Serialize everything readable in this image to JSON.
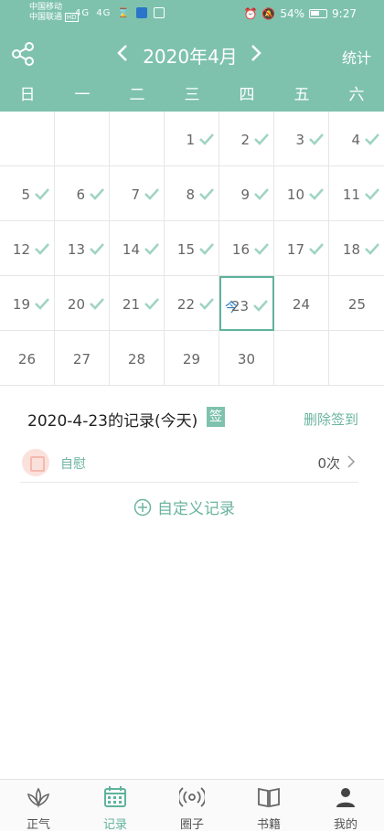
{
  "status_bar": {
    "carrier1": "中国移动",
    "carrier2": "中国联通",
    "hd": "HD",
    "signal1": "4G",
    "signal2": "4G",
    "battery": "54%",
    "time": "9:27"
  },
  "header": {
    "month_title": "2020年4月",
    "stats_label": "统计",
    "share_icon": "share-icon",
    "prev_icon": "chevron-left-icon",
    "next_icon": "chevron-right-icon",
    "bg_color": "#7ec2ad"
  },
  "weekdays": [
    "日",
    "一",
    "二",
    "三",
    "四",
    "五",
    "六"
  ],
  "calendar": {
    "rows": [
      [
        {
          "d": "",
          "c": false
        },
        {
          "d": "",
          "c": false
        },
        {
          "d": "",
          "c": false
        },
        {
          "d": "1",
          "c": true
        },
        {
          "d": "2",
          "c": true
        },
        {
          "d": "3",
          "c": true
        },
        {
          "d": "4",
          "c": true
        }
      ],
      [
        {
          "d": "5",
          "c": true
        },
        {
          "d": "6",
          "c": true
        },
        {
          "d": "7",
          "c": true
        },
        {
          "d": "8",
          "c": true
        },
        {
          "d": "9",
          "c": true
        },
        {
          "d": "10",
          "c": true
        },
        {
          "d": "11",
          "c": true
        }
      ],
      [
        {
          "d": "12",
          "c": true
        },
        {
          "d": "13",
          "c": true
        },
        {
          "d": "14",
          "c": true
        },
        {
          "d": "15",
          "c": true
        },
        {
          "d": "16",
          "c": true
        },
        {
          "d": "17",
          "c": true
        },
        {
          "d": "18",
          "c": true
        }
      ],
      [
        {
          "d": "19",
          "c": true
        },
        {
          "d": "20",
          "c": true
        },
        {
          "d": "21",
          "c": true
        },
        {
          "d": "22",
          "c": true
        },
        {
          "d": "23",
          "c": true,
          "today": true
        },
        {
          "d": "24",
          "c": false
        },
        {
          "d": "25",
          "c": false
        }
      ],
      [
        {
          "d": "26",
          "c": false
        },
        {
          "d": "27",
          "c": false
        },
        {
          "d": "28",
          "c": false
        },
        {
          "d": "29",
          "c": false
        },
        {
          "d": "30",
          "c": false
        },
        {
          "d": "",
          "c": false
        },
        {
          "d": "",
          "c": false
        }
      ]
    ],
    "today_mark": "今",
    "check_color": "#9fd3c4"
  },
  "record": {
    "title": "2020-4-23的记录(今天)",
    "sign_badge": "签",
    "delete_label": "删除签到",
    "item_label": "自慰",
    "item_count": "0次",
    "custom_label": "自定义记录"
  },
  "tabbar": {
    "tabs": [
      {
        "label": "正气",
        "icon": "lotus-icon",
        "active": false
      },
      {
        "label": "记录",
        "icon": "calendar-icon",
        "active": true
      },
      {
        "label": "圈子",
        "icon": "broadcast-icon",
        "active": false
      },
      {
        "label": "书籍",
        "icon": "book-icon",
        "active": false
      },
      {
        "label": "我的",
        "icon": "person-icon",
        "active": false
      }
    ]
  }
}
